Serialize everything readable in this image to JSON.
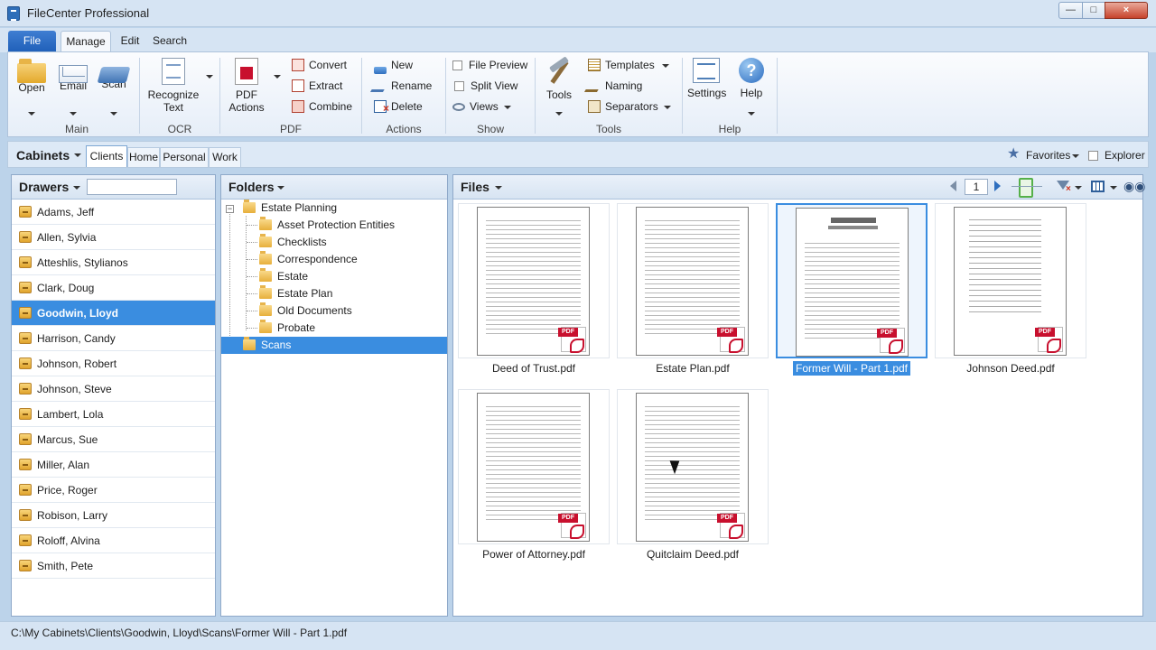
{
  "window": {
    "title": "FileCenter Professional"
  },
  "ribbon_tabs": [
    "File",
    "Manage",
    "Edit",
    "Search"
  ],
  "ribbon": {
    "main": {
      "label": "Main",
      "open": "Open",
      "email": "Email",
      "scan": "Scan"
    },
    "ocr": {
      "label": "OCR",
      "recognize_line1": "Recognize",
      "recognize_line2": "Text"
    },
    "pdf": {
      "label": "PDF",
      "actions_line1": "PDF",
      "actions_line2": "Actions",
      "convert": "Convert",
      "extract": "Extract",
      "combine": "Combine"
    },
    "actions": {
      "label": "Actions",
      "new": "New",
      "rename": "Rename",
      "delete": "Delete"
    },
    "show": {
      "label": "Show",
      "file_preview": "File Preview",
      "split_view": "Split View",
      "views": "Views"
    },
    "tools": {
      "label": "Tools",
      "tools": "Tools",
      "templates": "Templates",
      "naming": "Naming",
      "separators": "Separators"
    },
    "help": {
      "label": "Help",
      "settings": "Settings",
      "help": "Help"
    }
  },
  "cabinets": {
    "label": "Cabinets",
    "tabs": [
      "Clients",
      "Home",
      "Personal",
      "Work"
    ],
    "active_tab": "Clients",
    "favorites": "Favorites",
    "explorer": "Explorer"
  },
  "drawers": {
    "title": "Drawers",
    "search_value": "",
    "items": [
      "Adams, Jeff",
      "Allen, Sylvia",
      "Atteshlis, Stylianos",
      "Clark, Doug",
      "Goodwin, Lloyd",
      "Harrison, Candy",
      "Johnson, Robert",
      "Johnson, Steve",
      "Lambert, Lola",
      "Marcus, Sue",
      "Miller, Alan",
      "Price, Roger",
      "Robison, Larry",
      "Roloff, Alvina",
      "Smith, Pete"
    ],
    "selected": "Goodwin, Lloyd"
  },
  "folders": {
    "title": "Folders",
    "root": "Estate Planning",
    "children": [
      "Asset Protection Entities",
      "Checklists",
      "Correspondence",
      "Estate",
      "Estate Plan",
      "Old Documents",
      "Probate"
    ],
    "sibling": "Scans",
    "selected": "Scans",
    "toggle": "−"
  },
  "files": {
    "title": "Files",
    "page": "1",
    "items": [
      "Deed of Trust.pdf",
      "Estate Plan.pdf",
      "Former Will - Part 1.pdf",
      "Johnson Deed.pdf",
      "Power of Attorney.pdf",
      "Quitclaim Deed.pdf"
    ],
    "selected": "Former Will - Part 1.pdf"
  },
  "status": {
    "path": "C:\\My Cabinets\\Clients\\Goodwin, Lloyd\\Scans\\Former Will - Part 1.pdf"
  },
  "icons": [
    "app-icon",
    "open-folder-icon",
    "email-icon",
    "scanner-icon",
    "recognize-text-icon",
    "pdf-icon",
    "convert-icon",
    "extract-icon",
    "combine-icon",
    "new-icon",
    "rename-icon",
    "delete-icon",
    "views-icon",
    "tools-icon",
    "templates-icon",
    "naming-icon",
    "separators-icon",
    "settings-icon",
    "help-icon",
    "star-icon",
    "drawer-icon",
    "folder-icon",
    "prev-page-icon",
    "next-page-icon",
    "zoom-icon",
    "filter-icon",
    "grid-view-icon",
    "find-icon",
    "pdf-badge-icon"
  ],
  "colors": {
    "accent": "#3a8de0",
    "file_tab": "#2f6fbf",
    "pdf_red": "#c8102e"
  }
}
